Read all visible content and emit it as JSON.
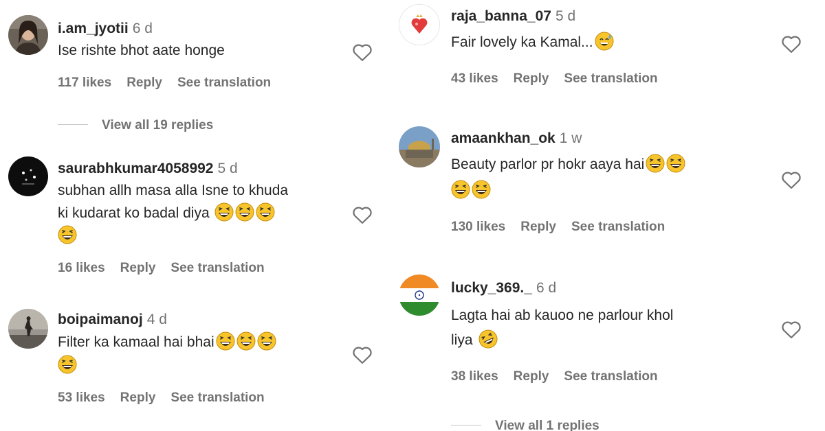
{
  "left": {
    "c1": {
      "username": "i.am_jyotii",
      "age": "6 d",
      "line1": "Ise rishte bhot aate honge",
      "likes": "117 likes",
      "reply": "Reply",
      "translate": "See translation",
      "avatar_icon": "profile-photo-woman"
    },
    "view_replies": "View all 19 replies",
    "c2": {
      "username": "saurabhkumar4058992",
      "age": "5 d",
      "line1": "subhan allh masa alla Isne to khuda",
      "line2": "ki kudarat ko badal diya",
      "likes": "16 likes",
      "reply": "Reply",
      "translate": "See translation",
      "avatar_icon": "profile-photo-dark"
    },
    "c3": {
      "username": "boipaimanoj",
      "age": "4 d",
      "line1": "Filter ka kamaal hai bhai",
      "likes": "53 likes",
      "reply": "Reply",
      "translate": "See translation",
      "avatar_icon": "profile-photo-silhouette"
    }
  },
  "right": {
    "c1": {
      "username": "raja_banna_07",
      "age": "5 d",
      "line1": "Fair lovely ka Kamal...",
      "likes": "43 likes",
      "reply": "Reply",
      "translate": "See translation",
      "avatar_icon": "heart-logo"
    },
    "c2": {
      "username": "amaankhan_ok",
      "age": "1 w",
      "line1": "Beauty parlor pr hokr aaya hai",
      "likes": "130 likes",
      "reply": "Reply",
      "translate": "See translation",
      "avatar_icon": "mosque-photo"
    },
    "c3": {
      "username": "lucky_369._",
      "age": "6 d",
      "line1": "Lagta hai ab kauoo ne parlour khol",
      "line2": "liya",
      "likes": "38 likes",
      "reply": "Reply",
      "translate": "See translation",
      "avatar_icon": "indian-flag"
    },
    "view_replies": "View all 1 replies"
  },
  "colors": {
    "text": "#262626",
    "muted": "#737373",
    "emoji_face": "#f7c52b",
    "flag_saffron": "#f08a24",
    "flag_green": "#2e8b2e",
    "flag_chakra": "#1a3a8a"
  }
}
